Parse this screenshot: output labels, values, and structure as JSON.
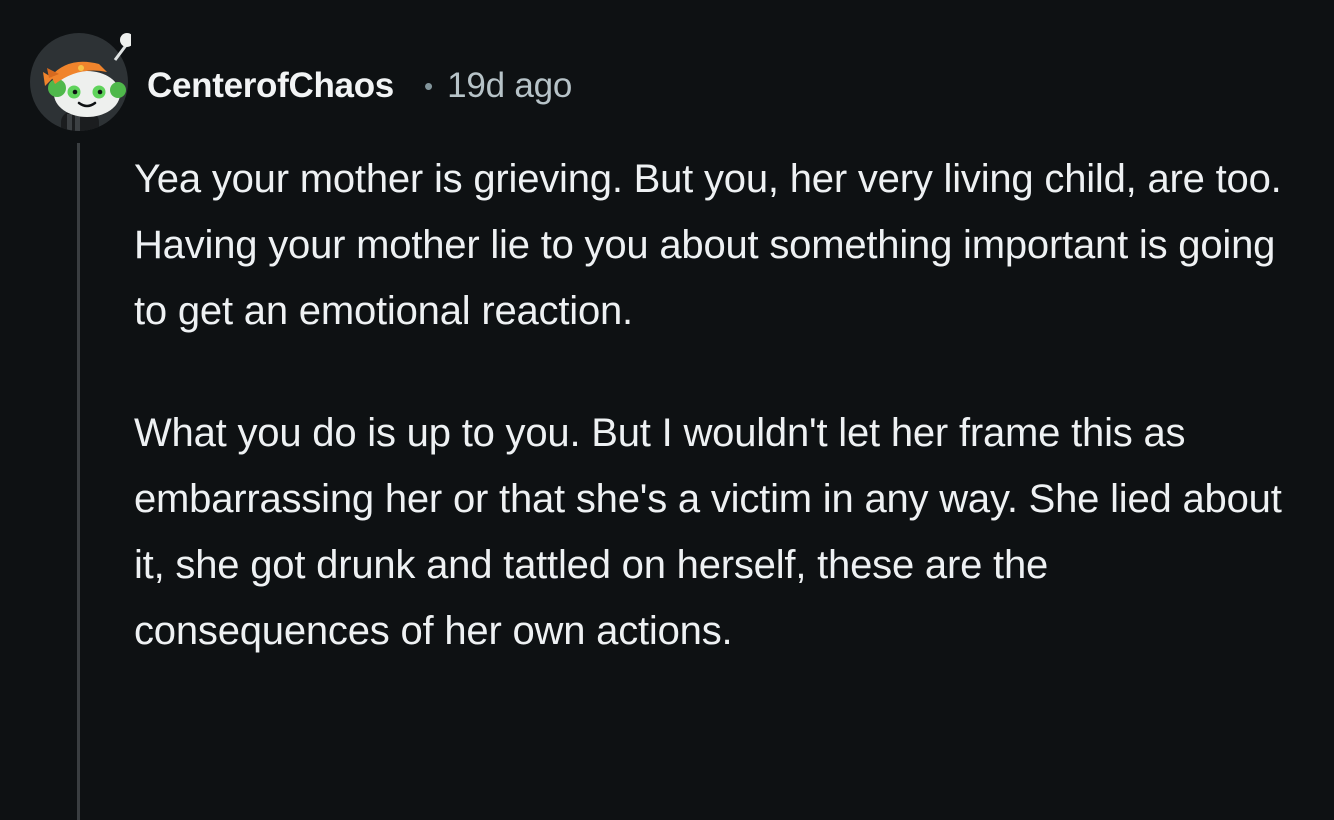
{
  "comment": {
    "author": "CenterofChaos",
    "separator": "•",
    "timestamp": "19d ago",
    "paragraphs": [
      "Yea your mother is grieving. But you, her very living child, are too. Having your mother lie to you about something important is going to get an emotional reaction.",
      "What you do is up to you. But I wouldn't let her frame this as embarrassing her or that she's a victim in any way. She lied about it, she got drunk and tattled on herself, these are the consequences of her own actions."
    ],
    "avatar": {
      "icon": "snoo-avatar-icon",
      "colors": {
        "background": "#2d3235",
        "head": "#eef0ee",
        "eyes": "#5fd35b",
        "bandana": "#f0842c",
        "accent": "#f6c247"
      }
    }
  },
  "theme": {
    "background": "#0e1113",
    "text": "#eef1f3",
    "muted": "#b7c3c8",
    "thread_line": "#3a3e41"
  }
}
